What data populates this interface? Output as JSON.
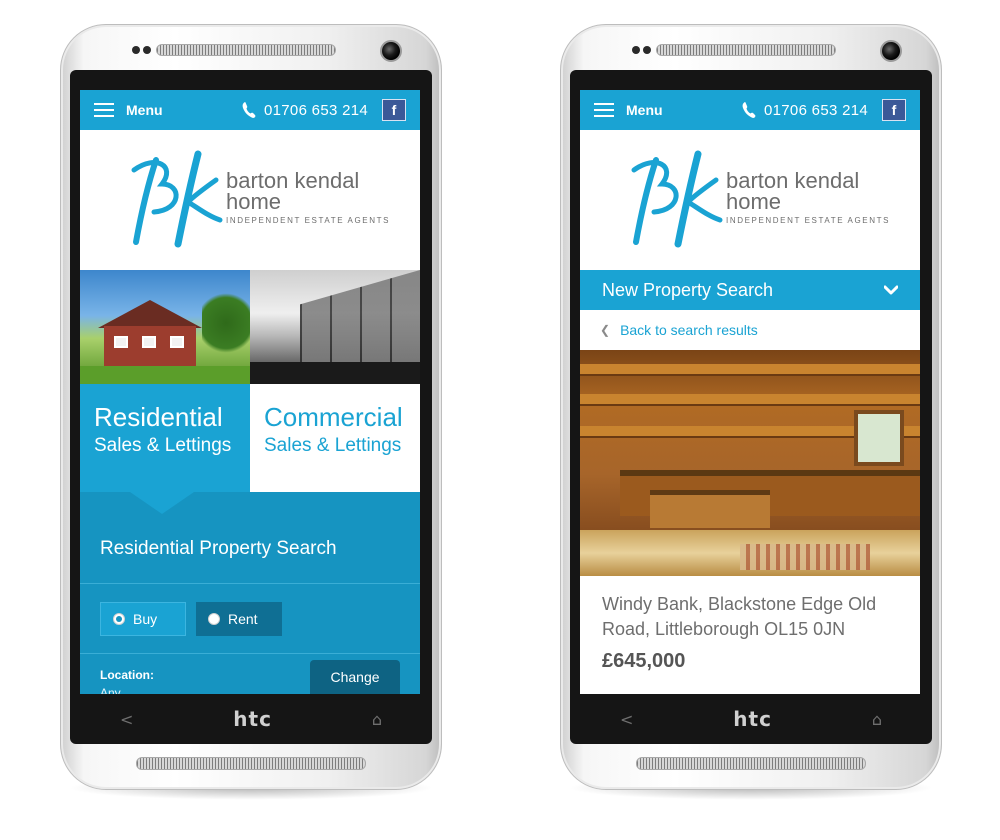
{
  "shared": {
    "menu_label": "Menu",
    "phone_number": "01706 653 214",
    "facebook_label": "f",
    "logo": {
      "line1": "barton kendal",
      "line2": "home",
      "line3": "INDEPENDENT ESTATE AGENTS"
    },
    "colors": {
      "brand_blue": "#1aa3d3",
      "panel_blue": "#1694c1",
      "facebook_blue": "#3b5998"
    }
  },
  "device": {
    "brand": "htc",
    "back_icon": "chevron-left-icon",
    "home_icon": "home-icon"
  },
  "left_screen": {
    "tiles": [
      {
        "title": "Residential",
        "subtitle": "Sales & Lettings"
      },
      {
        "title": "Commercial",
        "subtitle": "Sales & Lettings"
      }
    ],
    "search": {
      "heading": "Residential Property Search",
      "options": [
        {
          "label": "Buy",
          "selected": true
        },
        {
          "label": "Rent",
          "selected": false
        }
      ],
      "location_label": "Location:",
      "location_value": "Any",
      "change_label": "Change"
    }
  },
  "right_screen": {
    "collapse_title": "New Property Search",
    "back_label": "Back to search results",
    "address": "Windy Bank, Blackstone Edge Old Road, Littleborough OL15 0JN",
    "price": "£645,000"
  }
}
